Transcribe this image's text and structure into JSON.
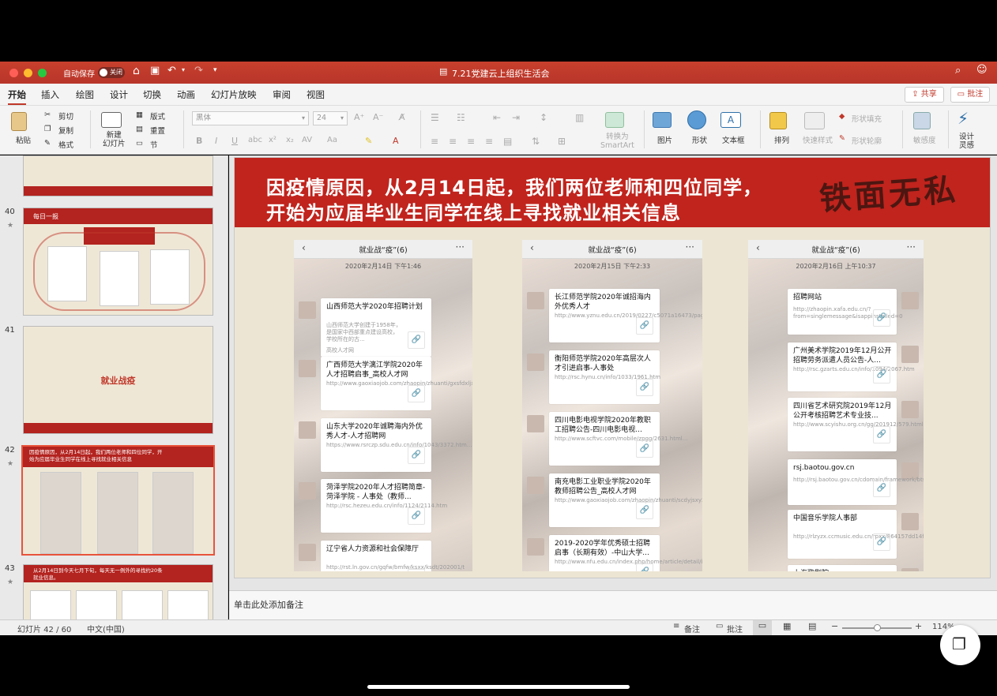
{
  "window": {
    "autosave_label": "自动保存",
    "autosave_state": "关闭",
    "doc_title": "7.21党建云上组织生活会"
  },
  "tabs": [
    "开始",
    "插入",
    "绘图",
    "设计",
    "切换",
    "动画",
    "幻灯片放映",
    "审阅",
    "视图"
  ],
  "header_buttons": {
    "share": "共享",
    "comments": "批注"
  },
  "ribbon": {
    "paste": "粘贴",
    "cut": "剪切",
    "copy": "复制",
    "format": "格式",
    "new_slide": "新建\n幻灯片",
    "layout": "版式",
    "reset": "重置",
    "section": "节",
    "font_name": "黑体",
    "font_size": "24",
    "convert_smartart": "转换为\nSmartArt",
    "picture": "图片",
    "shape": "形状",
    "textbox": "文本框",
    "arrange": "排列",
    "quick_styles": "快速样式",
    "shape_fill": "形状填充",
    "shape_outline": "形状轮廓",
    "sensitivity": "敏感度",
    "designer": "设计\n灵感"
  },
  "thumbnails": [
    {
      "num": "40",
      "title": "每日一报"
    },
    {
      "num": "41",
      "title": "就业战疫"
    },
    {
      "num": "42",
      "title": "因疫情原因，从2月14日起，我们两位老师和四位同学，开始为应届毕业生同学在线上寻找就业相关信息"
    },
    {
      "num": "43",
      "title": "从2月14日到今天七月下旬，每天无一例外的寻找约20条就业信息。"
    }
  ],
  "slide": {
    "banner_line1": "因疫情原因，从2月14日起，我们两位老师和四位同学，",
    "banner_line2": "开始为应届毕业生同学在线上寻找就业相关信息",
    "calligraphy": "铁面无私",
    "phones": [
      {
        "chat_title": "就业战“疫”(6)",
        "date": "2020年2月14日 下午1:46",
        "cards": [
          {
            "title": "山西师范大学2020年招聘计划",
            "url": "山西师范大学创建于1958年，是国家中西部重点建设高校，学校所在的古...",
            "source": "高校人才网"
          },
          {
            "title": "广西师范大学漓江学院2020年人才招聘启事_高校人才网",
            "url": "http://www.gaoxiaojob.com/zhaopin/zhuanti/gxsfdxljxy2019/index.html"
          },
          {
            "title": "山东大学2020年诚聘海内外优秀人才-人才招聘网",
            "url": "https://www.rsrczp.sdu.edu.cn/info/1043/3372.htm..."
          },
          {
            "title": "菏泽学院2020年人才招聘简章-菏泽学院 - 人事处（教师...",
            "url": "http://rsc.hezeu.edu.cn/info/1124/2114.htm"
          },
          {
            "title": "辽宁省人力资源和社会保障厅",
            "url": "http://rst.ln.gov.cn/gqfw/bmfw/ksxx/ksdt/202001/t"
          }
        ]
      },
      {
        "chat_title": "就业战“疫”(6)",
        "date": "2020年2月15日 下午2:33",
        "cards": [
          {
            "title": "长江师范学院2020年诚招海内外优秀人才",
            "url": "http://www.yznu.edu.cn/2019/0227/c5071a16473/page.htm"
          },
          {
            "title": "衡阳师范学院2020年高层次人才引进启事-人事处",
            "url": "http://rsc.hynu.cn/info/1033/1961.htm"
          },
          {
            "title": "四川电影电视学院2020年教职工招聘公告-四川电影电视...",
            "url": "http://www.scftvc.com/mobile/zpgg/2631.html..."
          },
          {
            "title": "南充电影工业职业学院2020年教师招聘公告_高校人才网",
            "url": "http://www.gaoxiaojob.com/zhaopin/zhuanti/scdyjsxy2019/index.html"
          },
          {
            "title": "2019-2020学年优秀硕士招聘启事（长期有效）-中山大学...",
            "url": "http://www.nfu.edu.cn/index.php/home/article/detail/id/4454/6721.html"
          }
        ]
      },
      {
        "chat_title": "就业战“疫”(6)",
        "date": "2020年2月16日 上午10:37",
        "cards": [
          {
            "title": "招聘网站",
            "url": "http://zhaopin.xafa.edu.cn/?from=singlemessage&isappinstalled=0"
          },
          {
            "title": "广州美术学院2019年12月公开招聘劳务派遣人员公告-人...",
            "url": "http://rsc.gzarts.edu.cn/info/1094/2067.htm"
          },
          {
            "title": "四川省艺术研究院2019年12月公开考核招聘艺术专业技...",
            "url": "http://www.scyishu.org.cn/gg/201912/579.html..."
          },
          {
            "title": "rsj.baotou.gov.cn",
            "url": "http://rsj.baotou.gov.cn/cdomain/framework/bts/index/mplepfdhekkmbb..."
          },
          {
            "title": "中国音乐学院人事部",
            "url": "http://rlzyzx.ccmusic.edu.cn/rpxx/864157dd14f24ebb97baac0d197c19d..."
          },
          {
            "title": "上海歌剧院",
            "url": ""
          }
        ]
      }
    ]
  },
  "notes_placeholder": "单击此处添加备注",
  "status": {
    "slide_count": "幻灯片 42 / 60",
    "language": "中文(中国)",
    "notes": "备注",
    "comments": "批注",
    "zoom": "114%"
  },
  "colors": {
    "accent": "#c0392b",
    "banner": "#c0241d"
  }
}
